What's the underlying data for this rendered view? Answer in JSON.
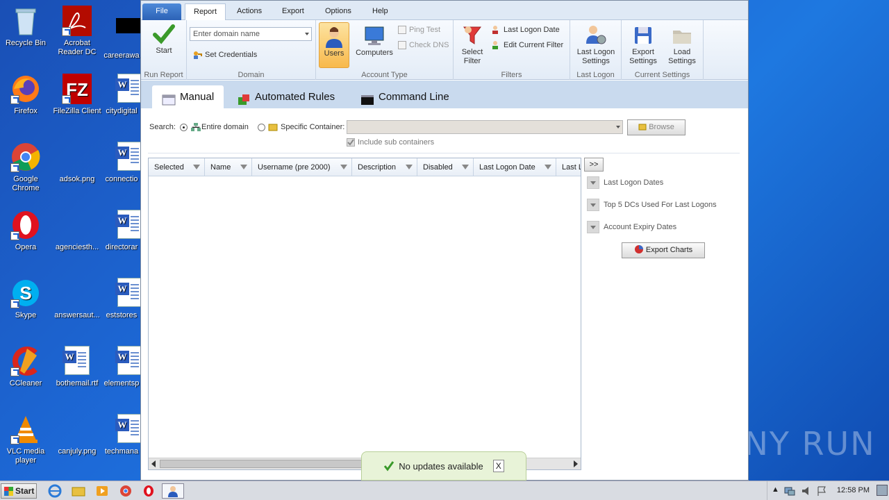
{
  "desktop": {
    "icons": [
      {
        "label": "Recycle Bin"
      },
      {
        "label": "Acrobat Reader DC"
      },
      {
        "label": "careerawa"
      },
      {
        "label": "Firefox"
      },
      {
        "label": "FileZilla Client"
      },
      {
        "label": "citydigital"
      },
      {
        "label": "Google Chrome"
      },
      {
        "label": "adsok.png"
      },
      {
        "label": "connectio"
      },
      {
        "label": "Opera"
      },
      {
        "label": "agenciesth..."
      },
      {
        "label": "directorar"
      },
      {
        "label": "Skype"
      },
      {
        "label": "answersaut..."
      },
      {
        "label": "eststores"
      },
      {
        "label": "CCleaner"
      },
      {
        "label": "bothemail.rtf"
      },
      {
        "label": "elementsp"
      },
      {
        "label": "VLC media player"
      },
      {
        "label": "canjuly.png"
      },
      {
        "label": "techmana"
      }
    ],
    "watermark": "ANY RUN"
  },
  "menu": {
    "file": "File",
    "report": "Report",
    "actions": "Actions",
    "export": "Export",
    "options": "Options",
    "help": "Help"
  },
  "ribbon": {
    "start": "Start",
    "run_report": "Run Report",
    "domain_placeholder": "Enter domain name",
    "set_credentials": "Set Credentials",
    "domain": "Domain",
    "users": "Users",
    "computers": "Computers",
    "ping_test": "Ping Test",
    "check_dns": "Check DNS",
    "account_type": "Account Type",
    "select_filter": "Select Filter",
    "last_logon_date": "Last Logon Date",
    "edit_current_filter": "Edit Current Filter",
    "filters": "Filters",
    "last_logon_settings": "Last Logon Settings",
    "last_logon": "Last Logon",
    "export_settings": "Export Settings",
    "load_settings": "Load Settings",
    "current_settings": "Current Settings"
  },
  "subtabs": {
    "manual": "Manual",
    "automated": "Automated Rules",
    "command": "Command Line"
  },
  "search": {
    "label": "Search:",
    "entire_domain": "Entire domain",
    "specific_container": "Specific Container:",
    "browse": "Browse",
    "include_sub": "Include sub containers"
  },
  "grid": {
    "columns": [
      "Selected",
      "Name",
      "Username (pre 2000)",
      "Description",
      "Disabled",
      "Last Logon Date",
      "Last L"
    ]
  },
  "side": {
    "expand": ">>",
    "last_logon_dates": "Last Logon Dates",
    "top5": "Top 5 DCs Used For Last Logons",
    "account_expiry": "Account Expiry Dates",
    "export_charts": "Export Charts"
  },
  "toast": {
    "text": "No updates available",
    "close": "X"
  },
  "taskbar": {
    "start": "Start",
    "clock": "12:58 PM"
  }
}
